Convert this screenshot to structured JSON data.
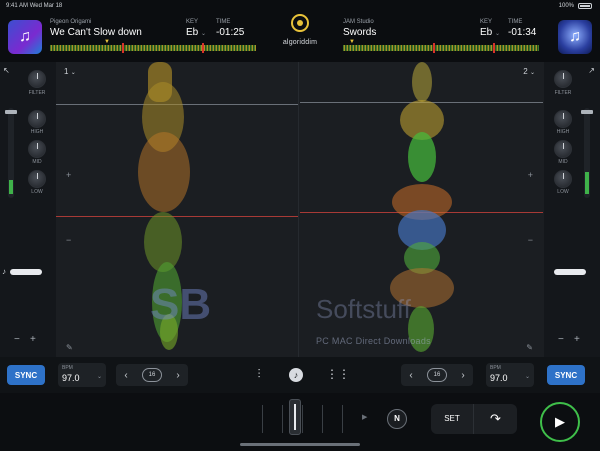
{
  "status_bar": {
    "time": "9:41 AM",
    "date": "Wed Mar 18",
    "battery": "100%"
  },
  "deck1": {
    "number": "1",
    "artist": "Pigeon Origami",
    "title": "We Can't Slow down",
    "key_label": "KEY",
    "key": "Eb",
    "time_label": "TIME",
    "time": "-01:25",
    "bpm_label": "BPM",
    "bpm": "97.0",
    "sync_label": "SYNC",
    "loop_size": "16"
  },
  "deck2": {
    "number": "2",
    "artist": "JAM Studio",
    "title": "Swords",
    "key_label": "KEY",
    "key": "Eb",
    "time_label": "TIME",
    "time": "-01:34",
    "bpm_label": "BPM",
    "bpm": "97.0",
    "sync_label": "SYNC",
    "loop_size": "16"
  },
  "logo": "algoriddim",
  "eq_labels": {
    "filter": "FILTER",
    "high": "HIGH",
    "mid": "MID",
    "low": "LOW"
  },
  "bottom": {
    "set_label": "SET",
    "n_label": "N"
  },
  "watermark": {
    "mark": "SB",
    "name": "Softstuff",
    "tagline": "PC MAC Direct Downloads"
  },
  "colors": {
    "accent": "#e8c23a",
    "sync": "#2e72c8",
    "play": "#3fbf4a"
  },
  "icons": [
    "music-note-icon",
    "equalizer-icon",
    "grid-icon",
    "play-icon",
    "redo-icon",
    "chevron-left-icon",
    "chevron-right-icon",
    "loop-icon",
    "pencil-icon"
  ]
}
